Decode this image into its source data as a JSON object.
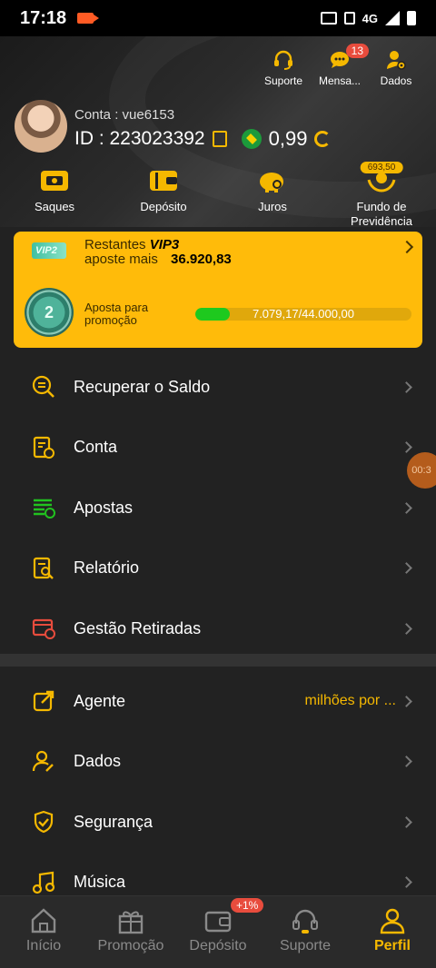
{
  "status_bar": {
    "time": "17:18",
    "network": "4G"
  },
  "header": {
    "actions": [
      {
        "label": "Suporte",
        "icon": "headset-icon"
      },
      {
        "label": "Mensa...",
        "icon": "chat-icon",
        "badge": "13"
      },
      {
        "label": "Dados",
        "icon": "user-gear-icon"
      }
    ],
    "account_label": "Conta : vue6153",
    "id_label": "ID : 223023392",
    "balance": "0,99"
  },
  "quick_actions": [
    {
      "label": "Saques",
      "icon": "wallet-withdraw-icon"
    },
    {
      "label": "Depósito",
      "icon": "wallet-icon"
    },
    {
      "label": "Juros",
      "icon": "piggy-bank-icon"
    },
    {
      "label_line1": "Fundo de",
      "label_line2": "Previdência",
      "badge": "693,50",
      "icon": "hands-coin-icon"
    }
  ],
  "vip": {
    "tag": "VIP2",
    "restantes_label": "Restantes",
    "restantes_level": "VIP3",
    "aposte_label": "aposte mais",
    "aposte_value": "36.920,83",
    "medal_level": "2",
    "promo_label_line1": "Aposta para",
    "promo_label_line2": "promoção",
    "progress_text": "7.079,17/44.000,00",
    "progress_fraction": 0.161
  },
  "menu_group1": [
    {
      "label": "Recuperar o Saldo",
      "icon": "recover-balance-icon"
    },
    {
      "label": "Conta",
      "icon": "account-doc-icon"
    },
    {
      "label": "Apostas",
      "icon": "bets-list-icon"
    },
    {
      "label": "Relatório",
      "icon": "report-search-icon"
    },
    {
      "label": "Gestão Retiradas",
      "icon": "withdraw-manage-icon"
    }
  ],
  "menu_group2": [
    {
      "label": "Agente",
      "extra": "milhões por ...",
      "icon": "share-icon"
    },
    {
      "label": "Dados",
      "icon": "user-edit-icon"
    },
    {
      "label": "Segurança",
      "icon": "shield-check-icon"
    },
    {
      "label": "Música",
      "icon": "music-icon"
    }
  ],
  "floating_timer": "00:3",
  "bottom_nav": [
    {
      "label": "Início",
      "icon": "home-icon"
    },
    {
      "label": "Promoção",
      "icon": "gift-icon"
    },
    {
      "label": "Depósito",
      "icon": "wallet-icon",
      "badge": "+1%"
    },
    {
      "label": "Suporte",
      "icon": "headset-icon"
    },
    {
      "label": "Perfil",
      "icon": "profile-icon",
      "active": true
    }
  ]
}
